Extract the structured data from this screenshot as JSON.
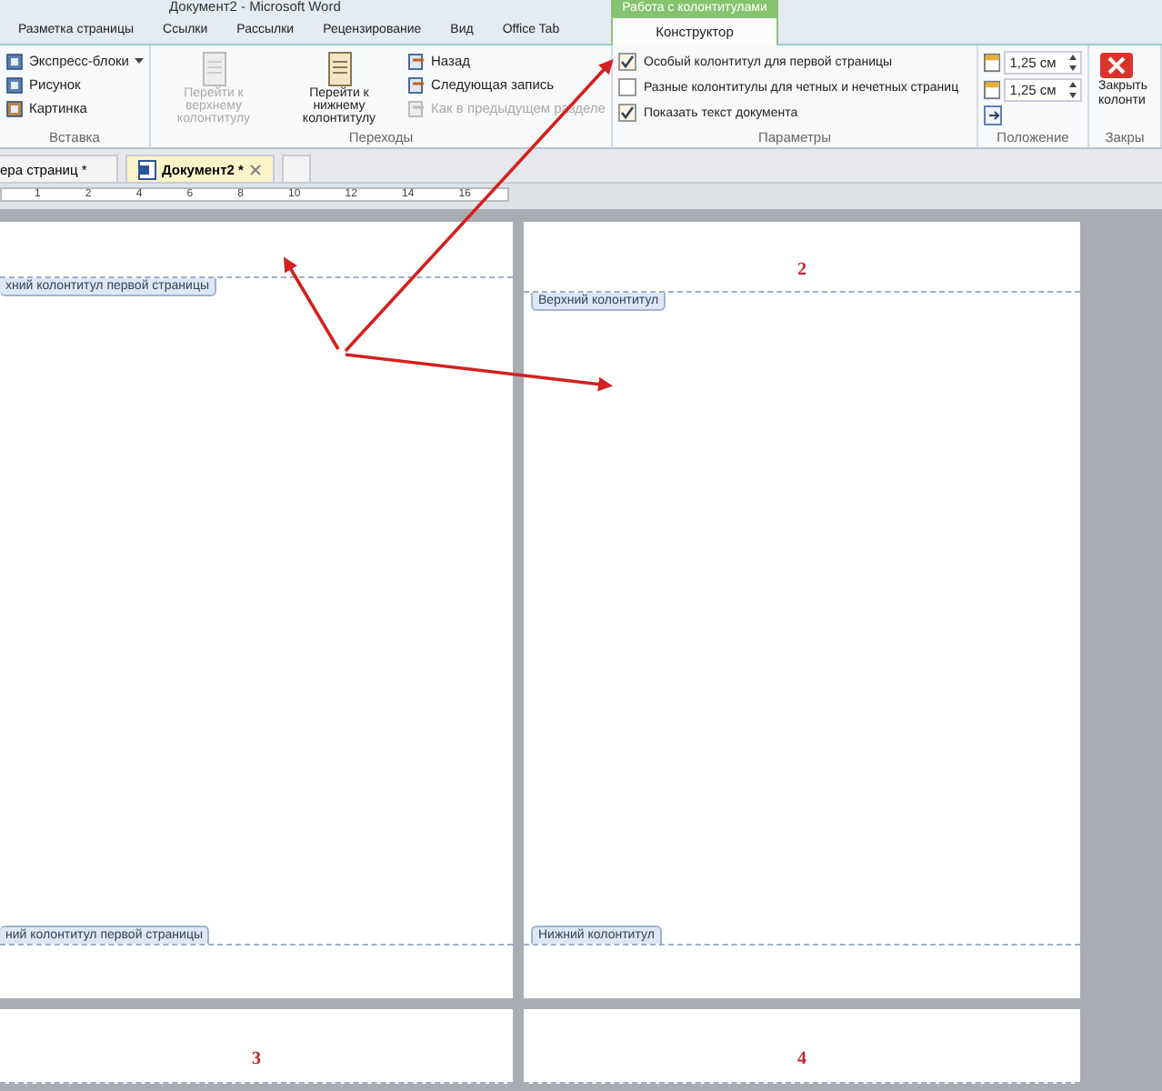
{
  "window": {
    "title": "Документ2 - Microsoft Word"
  },
  "ribbon_tabs": [
    {
      "label": "Разметка страницы",
      "selected": false
    },
    {
      "label": "Ссылки",
      "selected": false
    },
    {
      "label": "Рассылки",
      "selected": false
    },
    {
      "label": "Рецензирование",
      "selected": false
    },
    {
      "label": "Вид",
      "selected": false
    },
    {
      "label": "Office Tab",
      "selected": false
    }
  ],
  "context_tabs": {
    "label": "Работа с колонтитулами",
    "tabs": [
      {
        "label": "Конструктор",
        "selected": true
      }
    ]
  },
  "insert_group": {
    "label": "Вставка",
    "buttons": [
      {
        "label": "Экспресс-блоки",
        "dropdown": true
      },
      {
        "label": "Рисунок",
        "dropdown": false
      },
      {
        "label": "Картинка",
        "dropdown": false
      }
    ]
  },
  "navigation_group": {
    "label": "Переходы",
    "large_buttons": [
      {
        "label": "Перейти к верхнему колонтитулу",
        "disabled": true
      },
      {
        "label": "Перейти к нижнему колонтитулу",
        "disabled": false
      }
    ],
    "small_buttons": [
      {
        "label": "Назад",
        "disabled": false
      },
      {
        "label": "Следующая запись",
        "disabled": false
      },
      {
        "label": "Как в предыдущем разделе",
        "disabled": true
      }
    ]
  },
  "options_group": {
    "label": "Параметры",
    "checkboxes": [
      {
        "label": "Особый колонтитул для первой страницы",
        "checked": true
      },
      {
        "label": "Разные колонтитулы для четных и нечетных страниц",
        "checked": false
      },
      {
        "label": "Показать текст документа",
        "checked": true
      }
    ]
  },
  "position_group": {
    "label": "Положение",
    "spinners": [
      {
        "value": "1,25 см"
      },
      {
        "value": "1,25 см"
      }
    ]
  },
  "close_group": {
    "label": "Закры",
    "button": {
      "label": "Закрыть колонти"
    }
  },
  "document_tabs": [
    {
      "label": "ера страниц *",
      "selected": false,
      "closable": false
    },
    {
      "label": "Документ2 *",
      "selected": true,
      "closable": true
    }
  ],
  "ruler": {
    "labels": [
      "1",
      "2",
      "4",
      "6",
      "8",
      "10",
      "12",
      "14",
      "16"
    ]
  },
  "pages": [
    {
      "header_label": "хний колонтитул первой страницы",
      "footer_label": "ний колонтитул первой страницы"
    },
    {
      "number": "2",
      "header_label": "Верхний колонтитул",
      "footer_label": "Нижний колонтитул"
    },
    {
      "number": "3"
    },
    {
      "number": "4"
    }
  ]
}
